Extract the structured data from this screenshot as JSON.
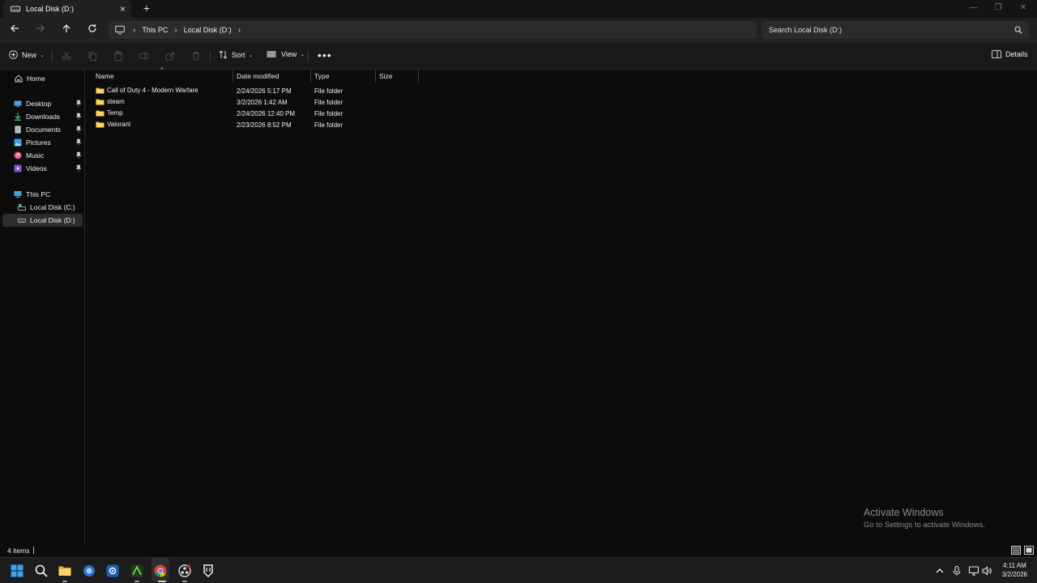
{
  "window": {
    "tab_title": "Local Disk (D:)",
    "new_tab_symbol": "+",
    "close_symbol": "×"
  },
  "address_bar": {
    "breadcrumbs": [
      "This PC",
      "Local Disk (D:)"
    ],
    "search_placeholder": "Search Local Disk (D:)"
  },
  "command_bar": {
    "new_label": "New",
    "sort_label": "Sort",
    "view_label": "View",
    "details_label": "Details"
  },
  "sidebar": {
    "home": "Home",
    "quick_access": [
      {
        "label": "Desktop",
        "icon": "desktop-icon",
        "pinned": true
      },
      {
        "label": "Downloads",
        "icon": "downloads-icon",
        "pinned": true
      },
      {
        "label": "Documents",
        "icon": "documents-icon",
        "pinned": true
      },
      {
        "label": "Pictures",
        "icon": "pictures-icon",
        "pinned": true
      },
      {
        "label": "Music",
        "icon": "music-icon",
        "pinned": true
      },
      {
        "label": "Videos",
        "icon": "videos-icon",
        "pinned": true
      }
    ],
    "this_pc": "This PC",
    "drives": [
      {
        "label": "Local Disk (C:)",
        "selected": false
      },
      {
        "label": "Local Disk (D:)",
        "selected": true
      }
    ]
  },
  "file_list": {
    "columns": [
      "Name",
      "Date modified",
      "Type",
      "Size"
    ],
    "rows": [
      {
        "name": "Call of Duty 4 - Modern Warfare",
        "date": "2/24/2026 5:17 PM",
        "type": "File folder",
        "size": ""
      },
      {
        "name": "steam",
        "date": "3/2/2026 1:42 AM",
        "type": "File folder",
        "size": ""
      },
      {
        "name": "Temp",
        "date": "2/24/2026 12:40 PM",
        "type": "File folder",
        "size": ""
      },
      {
        "name": "Valorant",
        "date": "2/23/2026 8:52 PM",
        "type": "File folder",
        "size": ""
      }
    ]
  },
  "status_bar": {
    "item_count": "4 items"
  },
  "watermark": {
    "line1": "Activate Windows",
    "line2": "Go to Settings to activate Windows."
  },
  "taskbar": {
    "time": "4:11 AM",
    "date": "3/2/2026"
  },
  "colors": {
    "background": "#0c0c0c",
    "folder": "#f3c14a",
    "accent": "#0078d4"
  }
}
